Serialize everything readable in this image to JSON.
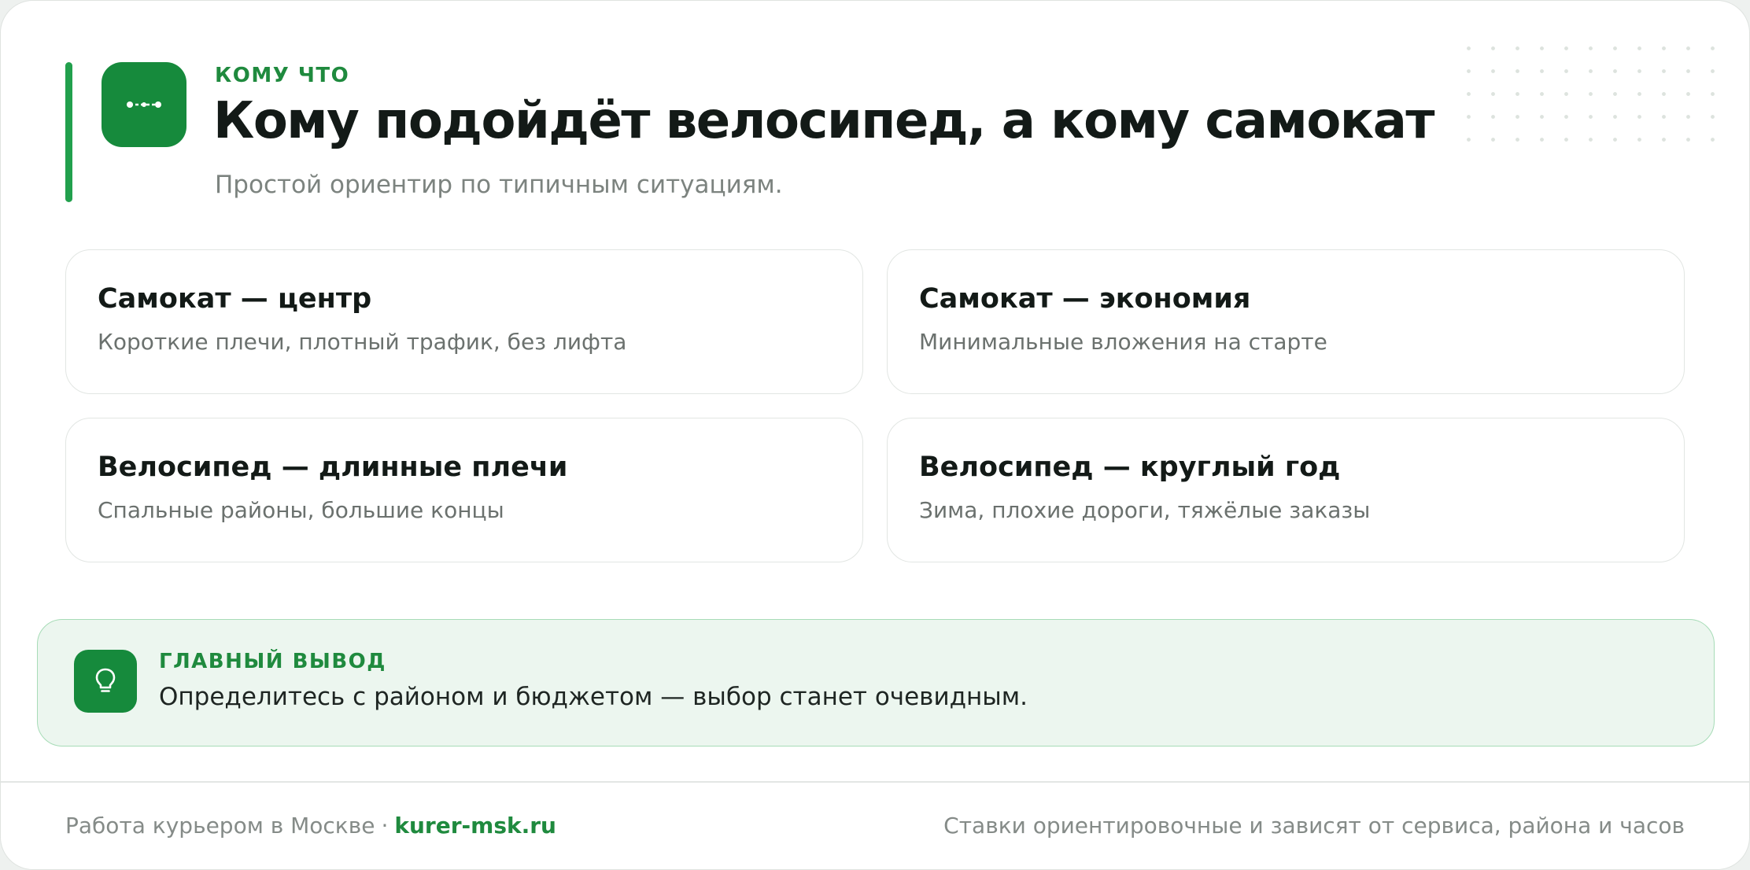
{
  "header": {
    "eyebrow": "КОМУ ЧТО",
    "title": "Кому подойдёт велосипед, а кому самокат",
    "subtitle": "Простой ориентир по типичным ситуациям.",
    "icon": "route-icon"
  },
  "items": [
    {
      "title": "Самокат — центр",
      "text": "Короткие плечи, плотный трафик, без лифта"
    },
    {
      "title": "Самокат — экономия",
      "text": "Минимальные вложения на старте"
    },
    {
      "title": "Велосипед — длинные плечи",
      "text": "Спальные районы, большие концы"
    },
    {
      "title": "Велосипед — круглый год",
      "text": "Зима, плохие дороги, тяжёлые заказы"
    }
  ],
  "conclusion": {
    "label": "ГЛАВНЫЙ ВЫВОД",
    "text": "Определитесь с районом и бюджетом — выбор станет очевидным.",
    "icon": "lightbulb-icon"
  },
  "footer": {
    "left_text": "Работа курьером в Москве",
    "separator": "·",
    "link": "kurer-msk.ru",
    "right_text": "Ставки ориентировочные и зависят от сервиса, района и часов"
  },
  "colors": {
    "accent": "#168a3c",
    "accent_text": "#1f8a3e",
    "conclusion_bg": "#ecf6ef"
  }
}
